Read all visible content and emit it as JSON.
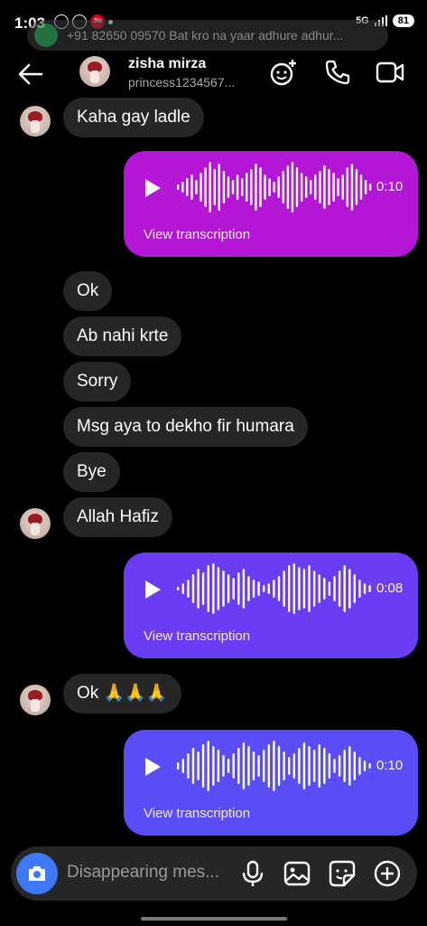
{
  "status_bar": {
    "time": "1:03",
    "battery": "81",
    "network": "5G"
  },
  "notification": {
    "text": "+91 82650 09570  Bat kro na yaar adhure adhur..."
  },
  "header": {
    "name": "zisha mirza",
    "username": "princess1234567..."
  },
  "messages": [
    {
      "type": "text",
      "text": "Kaha gay ladle"
    },
    {
      "type": "voice",
      "duration": "0:10",
      "transcription_label": "View transcription",
      "color": "#b416d6"
    },
    {
      "type": "text",
      "text": "Ok"
    },
    {
      "type": "text",
      "text": "Ab nahi krte"
    },
    {
      "type": "text",
      "text": "Sorry"
    },
    {
      "type": "text",
      "text": "Msg aya to dekho fir humara"
    },
    {
      "type": "text",
      "text": "Bye"
    },
    {
      "type": "text",
      "text": "Allah Hafiz"
    },
    {
      "type": "voice",
      "duration": "0:08",
      "transcription_label": "View transcription",
      "color": "#6a3cf4"
    },
    {
      "type": "text",
      "text": "Ok 🙏🙏🙏"
    },
    {
      "type": "voice",
      "duration": "0:10",
      "transcription_label": "View transcription",
      "color": "#5b4df5"
    }
  ],
  "composer": {
    "placeholder": "Disappearing mes..."
  },
  "colors": {
    "background": "#000000",
    "incoming_bubble": "#262626",
    "camera_button": "#3e78f5"
  }
}
